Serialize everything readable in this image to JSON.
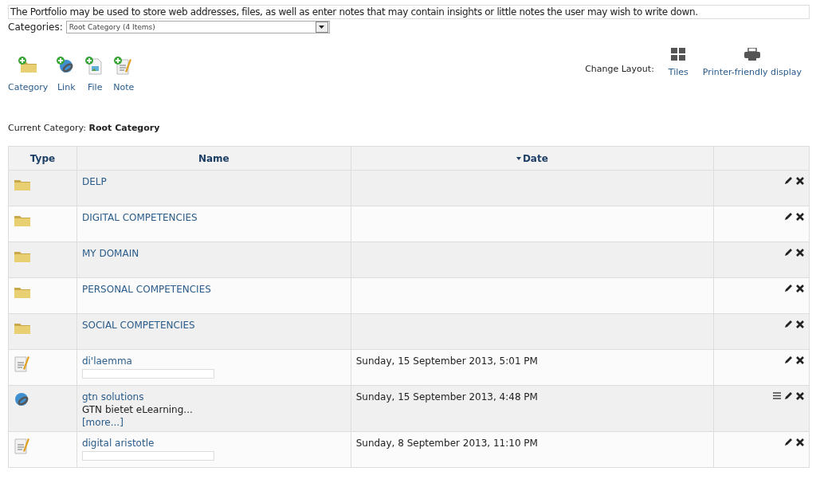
{
  "intro": "The Portfolio may be used to store web addresses, files, as well as enter notes that may contain insights or little notes the user may wish to write down.",
  "categories": {
    "label": "Categories:",
    "value": "Root Category (4 Items)"
  },
  "add_toolbar": [
    {
      "kind": "category",
      "label": "Category"
    },
    {
      "kind": "link",
      "label": "Link"
    },
    {
      "kind": "file",
      "label": "File"
    },
    {
      "kind": "note",
      "label": "Note"
    }
  ],
  "layout": {
    "label": "Change Layout:",
    "options": [
      {
        "kind": "tiles",
        "label": "Tiles"
      },
      {
        "kind": "print",
        "label": "Printer-friendly display"
      }
    ]
  },
  "current_category": {
    "label": "Current Category:",
    "value": "Root Category"
  },
  "table": {
    "columns": [
      {
        "label": "Type",
        "sorted": false
      },
      {
        "label": "Name",
        "sorted": false
      },
      {
        "label": "Date",
        "sorted": true
      },
      {
        "sorted": false
      }
    ],
    "rows": [
      {
        "kind": "folder",
        "name": "DELP"
      },
      {
        "kind": "folder",
        "name": "DIGITAL COMPETENCIES"
      },
      {
        "kind": "folder",
        "name": "MY DOMAIN"
      },
      {
        "kind": "folder",
        "name": "PERSONAL COMPETENCIES"
      },
      {
        "kind": "folder",
        "name": "SOCIAL COMPETENCIES"
      },
      {
        "kind": "note",
        "name": "di'laemma",
        "date": "Sunday, 15 September 2013, 5:01 PM"
      },
      {
        "kind": "link",
        "name": "gtn solutions",
        "description": "GTN bietet eLearning...",
        "more": "[more...]",
        "date": "Sunday, 15 September 2013, 4:48 PM"
      },
      {
        "kind": "note",
        "name": "digital aristotle",
        "date": "Sunday, 8 September 2013, 11:10 PM"
      }
    ]
  }
}
